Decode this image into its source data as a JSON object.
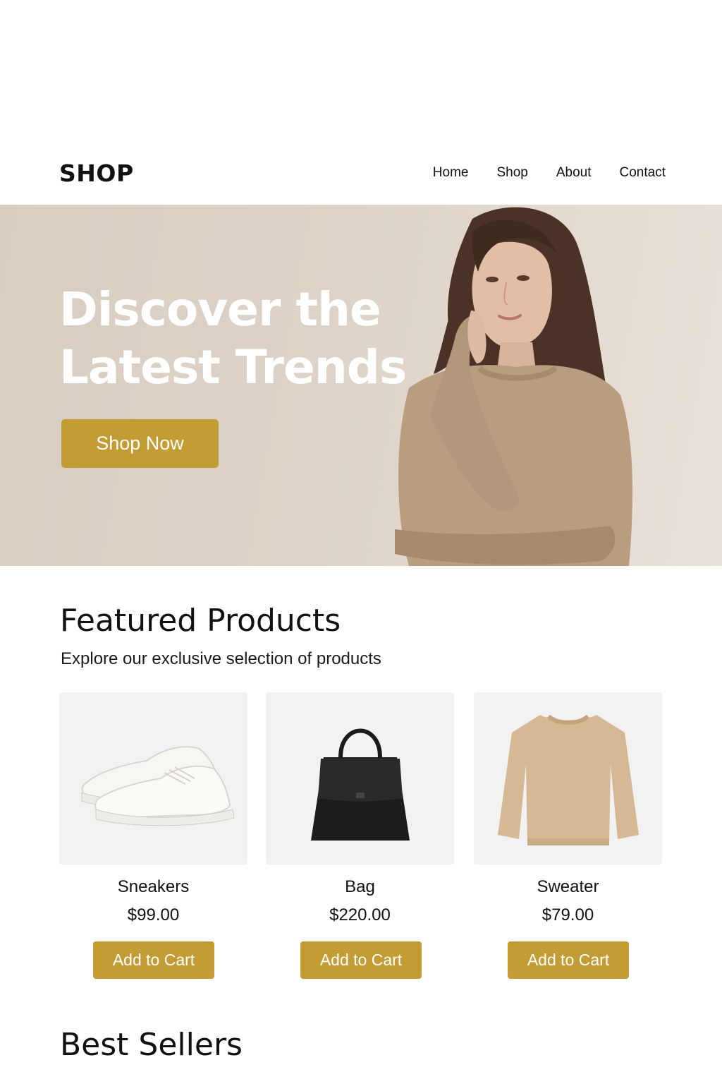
{
  "header": {
    "logo": "SHOP",
    "nav": [
      "Home",
      "Shop",
      "About",
      "Contact"
    ]
  },
  "hero": {
    "title_line1": "Discover the",
    "title_line2": "Latest Trends",
    "cta": "Shop Now"
  },
  "featured": {
    "title": "Featured Products",
    "subtitle": "Explore our exclusive selection of products",
    "products": [
      {
        "name": "Sneakers",
        "price": "$99.00",
        "button": "Add to Cart",
        "image": "sneakers-image"
      },
      {
        "name": "Bag",
        "price": "$220.00",
        "button": "Add to Cart",
        "image": "bag-image"
      },
      {
        "name": "Sweater",
        "price": "$79.00",
        "button": "Add to Cart",
        "image": "sweater-image"
      }
    ]
  },
  "best_sellers": {
    "title": "Best Sellers"
  },
  "colors": {
    "accent": "#c49c34",
    "hero_bg": "#dcd2c7",
    "text": "#111111"
  }
}
